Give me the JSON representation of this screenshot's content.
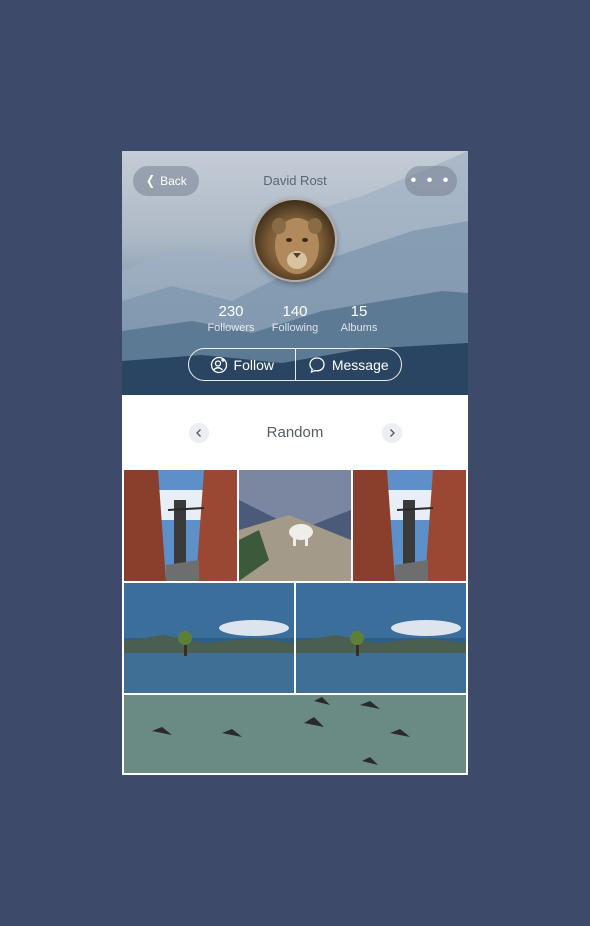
{
  "header": {
    "back_label": "Back",
    "profile_name": "David Rost",
    "more_label": "• • •"
  },
  "stats": [
    {
      "value": "230",
      "label": "Followers"
    },
    {
      "value": "140",
      "label": "Following"
    },
    {
      "value": "15",
      "label": "Albums"
    }
  ],
  "actions": {
    "follow_label": "Follow",
    "message_label": "Message"
  },
  "album": {
    "title": "Random"
  },
  "colors": {
    "background": "#3d4a6a",
    "card": "#ffffff"
  },
  "icons": {
    "back": "chevron-left-icon",
    "more": "more-dots-icon",
    "follow": "add-user-icon",
    "message": "chat-bubble-icon",
    "prev": "chevron-left-icon",
    "next": "chevron-right-icon"
  }
}
